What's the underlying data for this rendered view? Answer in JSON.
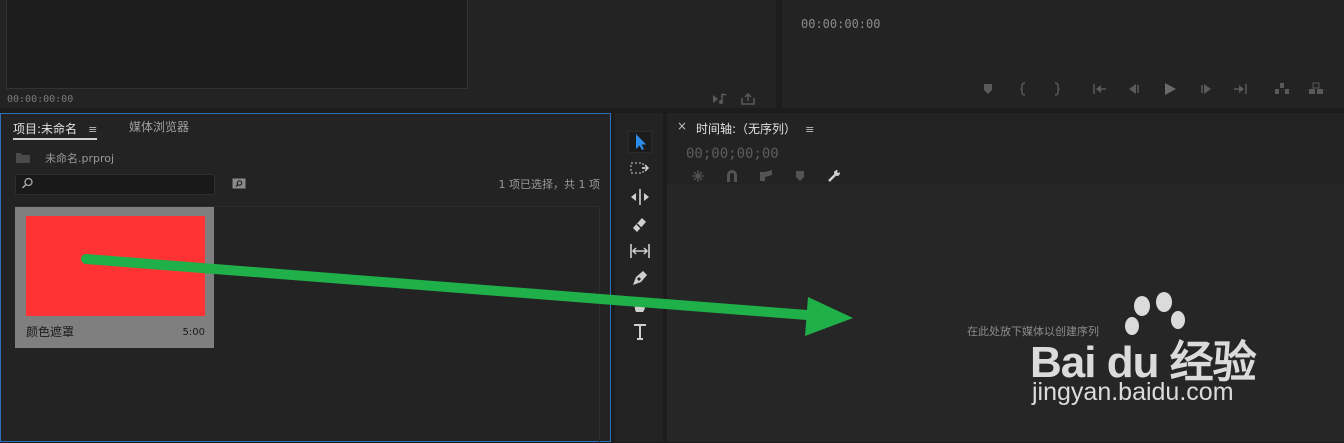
{
  "source_monitor": {
    "timecode": "00:00:00:00"
  },
  "program_monitor": {
    "timecode": "00:00:00:00"
  },
  "project_panel": {
    "tab_label": "项目:未命名",
    "menu_icon": "hamburger-icon",
    "media_browser_tab": "媒体浏览器",
    "project_file": "未命名.prproj",
    "search_placeholder": "",
    "selection_status": "1 项已选择，共 1 项",
    "clip": {
      "name": "颜色遮罩",
      "duration": "5:00",
      "color": "#ff3333"
    }
  },
  "tools": [
    "selection-tool-icon",
    "track-select-tool-icon",
    "ripple-edit-tool-icon",
    "razor-tool-icon",
    "slip-tool-icon",
    "pen-tool-icon",
    "hand-tool-icon",
    "type-tool-icon"
  ],
  "timeline": {
    "close_label": "×",
    "title": "时间轴:（无序列）",
    "timecode": "00;00;00;00",
    "drop_hint": "在此处放下媒体以创建序列"
  },
  "annotation": {
    "arrow_color": "#1fb04a"
  },
  "watermark": {
    "brand": "Bai du 经验",
    "url": "jingyan.baidu.com"
  },
  "colors": {
    "accent": "#2d8ceb",
    "panel_bg": "#232323",
    "app_bg": "#1c1c1c"
  }
}
